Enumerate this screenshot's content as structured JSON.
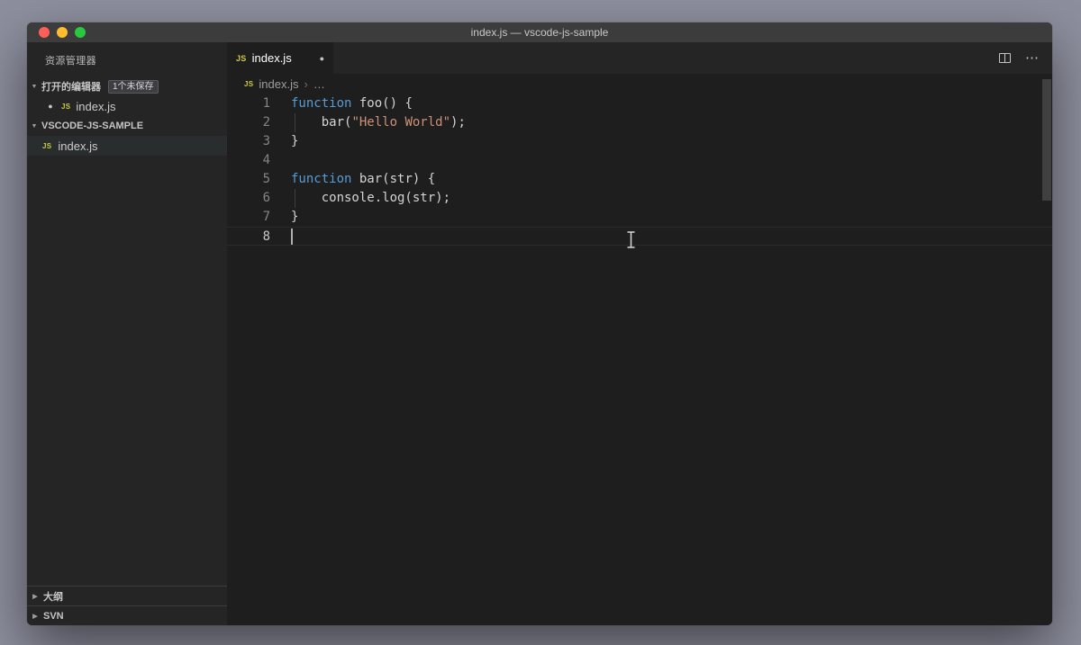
{
  "window": {
    "title": "index.js — vscode-js-sample"
  },
  "icons": {
    "js_badge": "JS",
    "modified_dot": "●",
    "chevron_expanded": "▼",
    "chevron_collapsed": "▶",
    "breadcrumb_separator": "›",
    "more_actions": "⋯"
  },
  "sidebar": {
    "title": "资源管理器",
    "open_editors": {
      "label": "打开的编辑器",
      "badge": "1个未保存",
      "items": [
        {
          "label": "index.js",
          "modified": true
        }
      ]
    },
    "project": {
      "label": "VSCODE-JS-SAMPLE",
      "files": [
        {
          "label": "index.js",
          "selected": true
        }
      ]
    },
    "panels": [
      {
        "label": "大纲"
      },
      {
        "label": "SVN"
      }
    ]
  },
  "editor": {
    "tab": {
      "label": "index.js",
      "modified": true
    },
    "breadcrumb": {
      "file": "index.js",
      "more": "…"
    },
    "token_colors": {
      "kw": "#569cd6",
      "str": "#ce9178",
      "pl": "#d4d4d4"
    },
    "code": [
      {
        "num": "1",
        "tokens": [
          {
            "c": "kw",
            "t": "function"
          },
          {
            "c": "pl",
            "t": " foo() {"
          }
        ]
      },
      {
        "num": "2",
        "indent_guide": true,
        "tokens": [
          {
            "c": "pl",
            "t": "    bar("
          },
          {
            "c": "str",
            "t": "\"Hello World\""
          },
          {
            "c": "pl",
            "t": ");"
          }
        ]
      },
      {
        "num": "3",
        "tokens": [
          {
            "c": "pl",
            "t": "}"
          }
        ]
      },
      {
        "num": "4",
        "tokens": []
      },
      {
        "num": "5",
        "tokens": [
          {
            "c": "kw",
            "t": "function"
          },
          {
            "c": "pl",
            "t": " bar(str) {"
          }
        ]
      },
      {
        "num": "6",
        "indent_guide": true,
        "tokens": [
          {
            "c": "pl",
            "t": "    console.log(str);"
          }
        ]
      },
      {
        "num": "7",
        "tokens": [
          {
            "c": "pl",
            "t": "}"
          }
        ]
      },
      {
        "num": "8",
        "active": true,
        "cursor": true,
        "tokens": []
      }
    ]
  }
}
